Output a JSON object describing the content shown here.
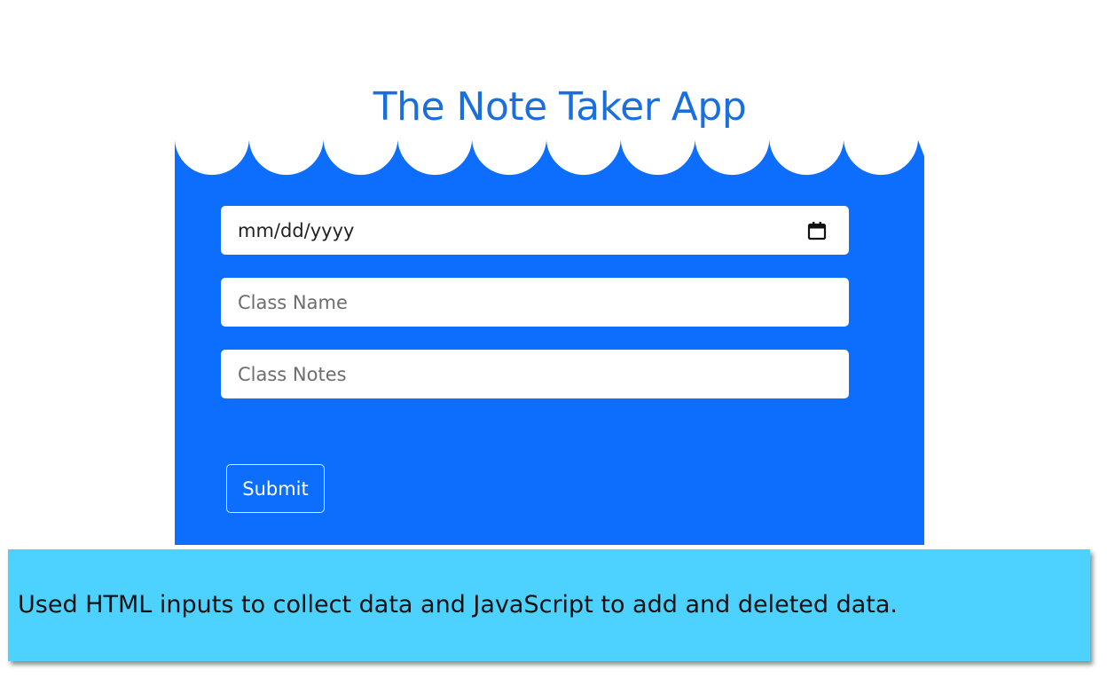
{
  "app": {
    "title": "The Note Taker App"
  },
  "form": {
    "date_field": {
      "value": "mm/dd/yyyy",
      "icon": "calendar-icon"
    },
    "class_name_field": {
      "placeholder": "Class Name"
    },
    "class_notes_field": {
      "placeholder": "Class Notes"
    },
    "submit_label": "Submit"
  },
  "caption": {
    "text": "Used HTML inputs to collect data and JavaScript to add and deleted data."
  },
  "colors": {
    "title": "#1a6fe0",
    "panel": "#0d6efd",
    "field_bg": "#ffffff",
    "caption_bg": "#4dd1fe"
  }
}
